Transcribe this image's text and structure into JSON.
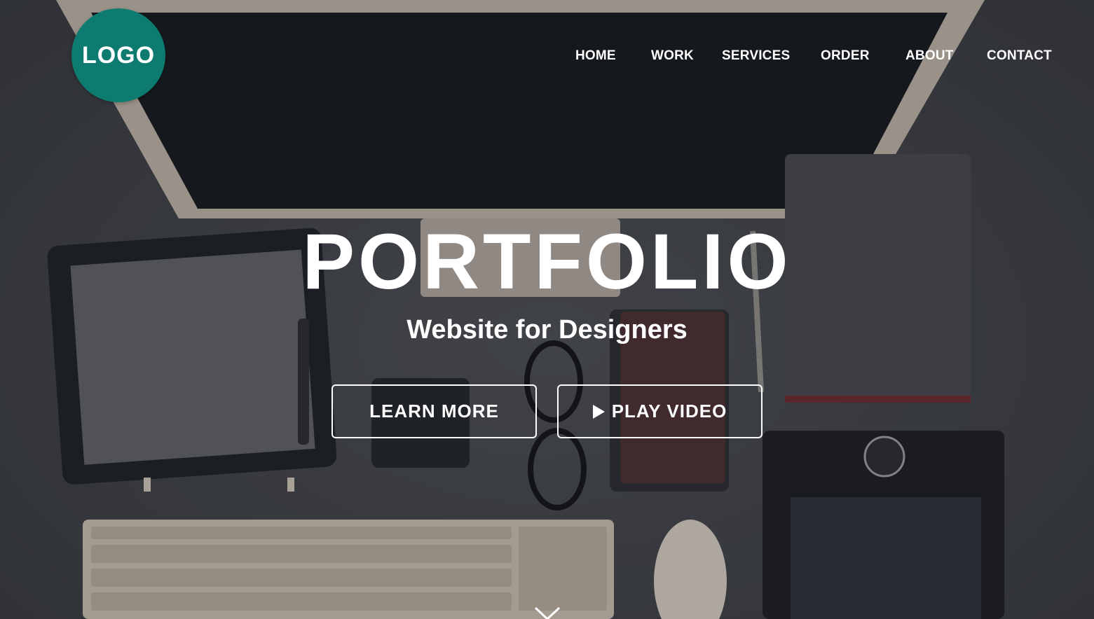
{
  "logo": {
    "text": "LOGO"
  },
  "nav": {
    "items": [
      {
        "label": "HOME"
      },
      {
        "label": "WORK"
      },
      {
        "label": "SERVICES"
      },
      {
        "label": "ORDER"
      },
      {
        "label": "ABOUT"
      },
      {
        "label": "CONTACT"
      }
    ]
  },
  "hero": {
    "title": "PORTFOLIO",
    "subtitle": "Website for Designers",
    "learn_more_label": "LEARN MORE",
    "play_video_label": "PLAY VIDEO"
  },
  "icons": {
    "play": "play-icon",
    "scroll": "chevron-down-icon"
  },
  "colors": {
    "logo_bg": "#0d7b70",
    "text": "#ffffff"
  }
}
